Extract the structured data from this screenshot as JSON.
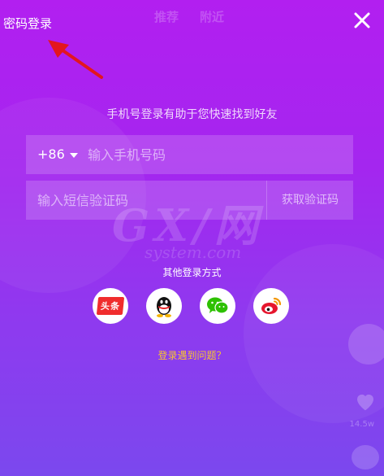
{
  "header": {
    "password_login_label": "密码登录",
    "close_label": "关闭",
    "bg_tabs": [
      "推荐",
      "附近"
    ]
  },
  "login": {
    "hint": "手机号登录有助于您快速找到好友",
    "country_code": "+86",
    "phone_placeholder": "输入手机号码",
    "code_placeholder": "输入短信验证码",
    "get_code_label": "获取验证码"
  },
  "other": {
    "title": "其他登录方式",
    "providers": [
      {
        "name": "toutiao",
        "icon": "toutiao-icon",
        "badge_text": "头条"
      },
      {
        "name": "qq",
        "icon": "qq-icon"
      },
      {
        "name": "wechat",
        "icon": "wechat-icon"
      },
      {
        "name": "weibo",
        "icon": "weibo-icon"
      }
    ],
    "trouble_link": "登录遇到问题？"
  },
  "watermark": {
    "big": "GX/网",
    "small": "system.com"
  },
  "background": {
    "like_count": "14.5w"
  },
  "colors": {
    "gradient_top": "#b21ff0",
    "gradient_bottom": "#7b48ee",
    "link": "#f7c531",
    "toutiao_red": "#f02d2d",
    "annotation_arrow": "#e3161e"
  }
}
